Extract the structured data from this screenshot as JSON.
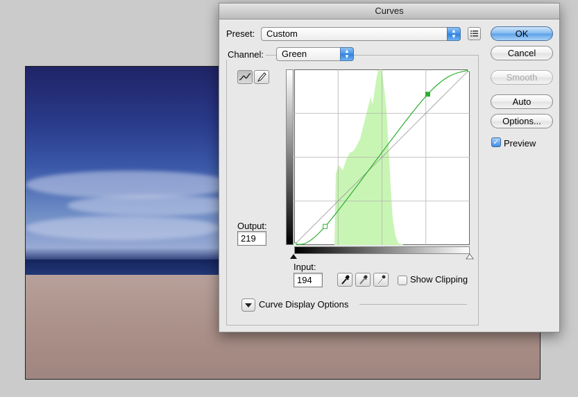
{
  "dialog": {
    "title": "Curves",
    "preset_label": "Preset:",
    "preset_value": "Custom",
    "channel_label": "Channel:",
    "channel_value": "Green",
    "output_label": "Output:",
    "output_value": "219",
    "input_label": "Input:",
    "input_value": "194",
    "show_clipping_label": "Show Clipping",
    "show_clipping_checked": false,
    "curve_display_options_label": "Curve Display Options",
    "buttons": {
      "ok": "OK",
      "cancel": "Cancel",
      "smooth": "Smooth",
      "auto": "Auto",
      "options": "Options..."
    },
    "preview_label": "Preview",
    "preview_checked": true
  },
  "curve": {
    "input_range": [
      0,
      255
    ],
    "output_range": [
      0,
      255
    ],
    "grid_divisions": 4,
    "points": [
      [
        0,
        0
      ],
      [
        45,
        27
      ],
      [
        194,
        219
      ],
      [
        255,
        255
      ]
    ],
    "selected_point": [
      194,
      219
    ],
    "color": "#2fae2f",
    "histogram_color": "#c8f5b4"
  },
  "colors": {
    "accent": "#3f8ee8",
    "dialog_bg": "#e8e8e8"
  },
  "icons": [
    "curve-tool-icon",
    "pencil-tool-icon",
    "preset-options-icon",
    "black-eyedropper-icon",
    "gray-eyedropper-icon",
    "white-eyedropper-icon",
    "disclosure-triangle-icon"
  ]
}
